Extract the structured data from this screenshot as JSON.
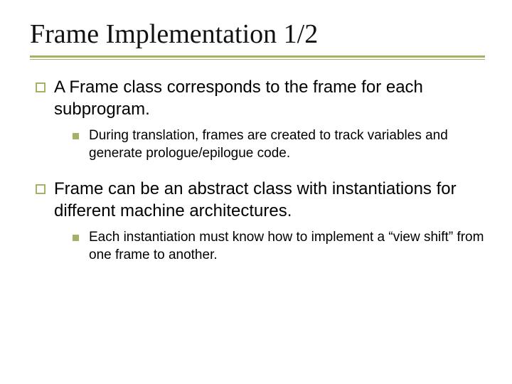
{
  "slide": {
    "title": "Frame Implementation 1/2",
    "bullets": [
      {
        "text": "A Frame class corresponds to the frame for each subprogram.",
        "sub": [
          {
            "text": "During translation, frames are created to track variables and generate prologue/epilogue code."
          }
        ]
      },
      {
        "text": "Frame can be an abstract class with instantiations for different machine architectures.",
        "sub": [
          {
            "text": "Each instantiation must know how to implement a “view shift” from one frame to another."
          }
        ]
      }
    ]
  },
  "colors": {
    "accent": "#a6b066"
  }
}
